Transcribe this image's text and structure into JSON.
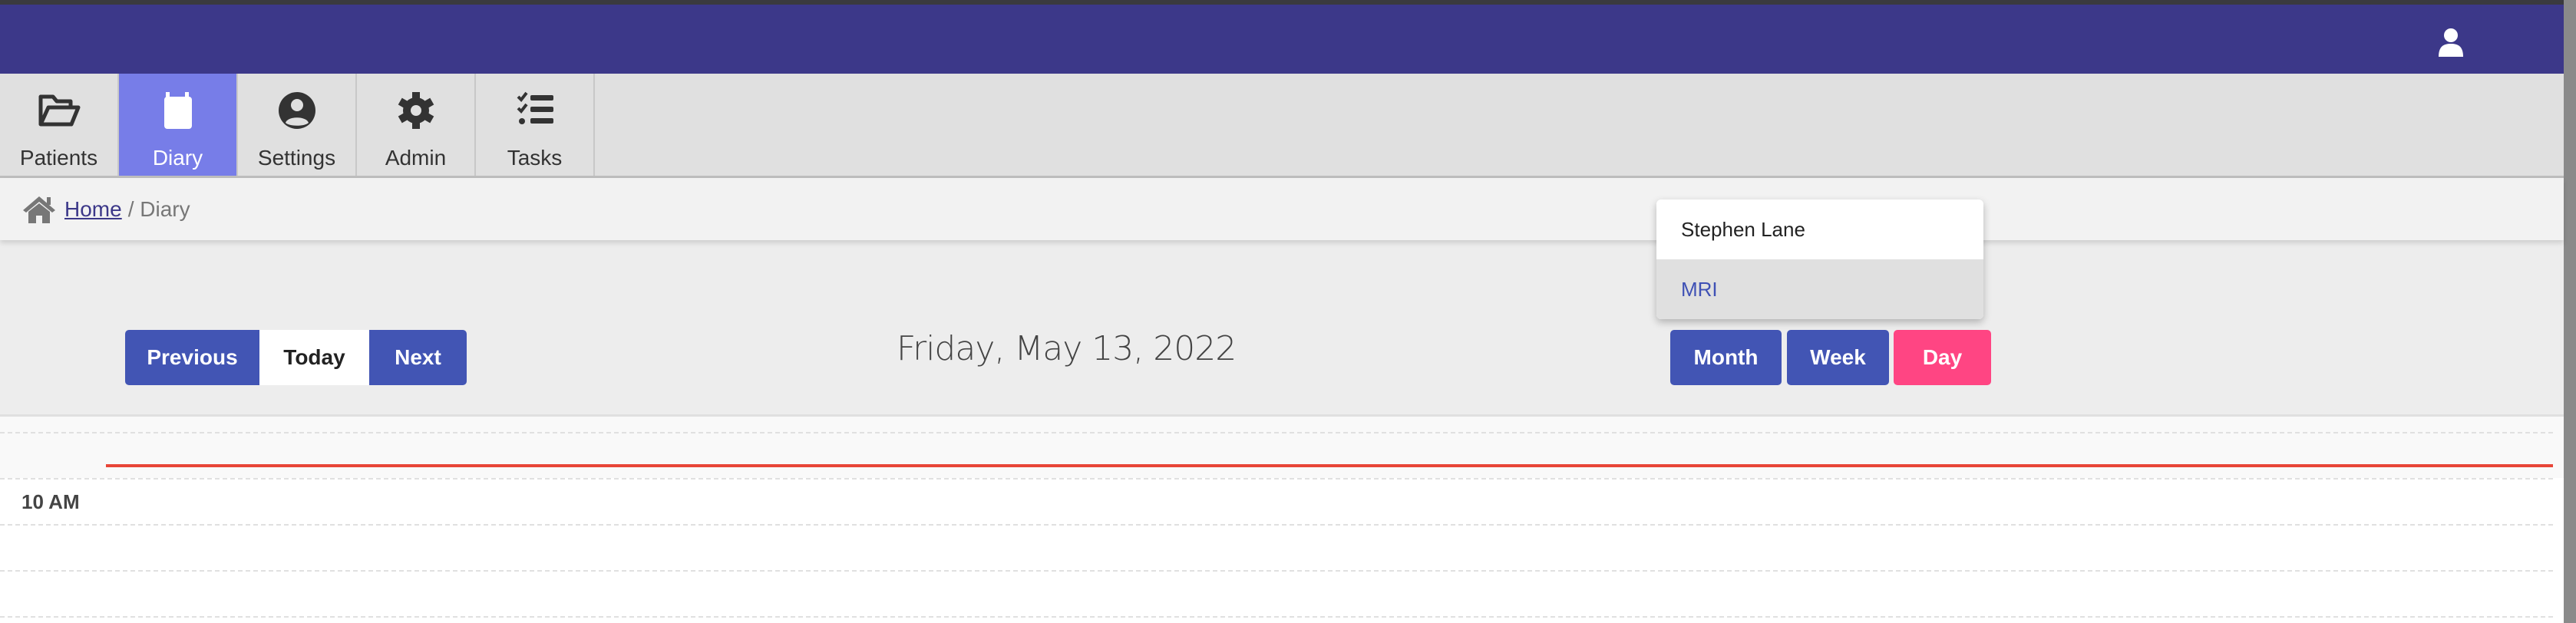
{
  "nav": {
    "tabs": [
      {
        "label": "Patients",
        "icon": "folder-open-icon"
      },
      {
        "label": "Diary",
        "icon": "calendar-icon",
        "active": true
      },
      {
        "label": "Settings",
        "icon": "user-circle-icon"
      },
      {
        "label": "Admin",
        "icon": "gear-icon"
      },
      {
        "label": "Tasks",
        "icon": "tasks-icon"
      }
    ]
  },
  "breadcrumb": {
    "home": "Home",
    "separator": "/",
    "current": "Diary"
  },
  "toolbar": {
    "previous": "Previous",
    "today": "Today",
    "next": "Next",
    "date": "Friday, May 13, 2022",
    "month": "Month",
    "week": "Week",
    "day": "Day"
  },
  "dropdown": {
    "items": [
      "Stephen Lane",
      "MRI"
    ]
  },
  "calendar": {
    "hour_label": "10 AM"
  },
  "colors": {
    "header": "#3c3889",
    "active_tab": "#777de8",
    "primary_button": "#4255b4",
    "active_view": "#ff4583",
    "now_line": "#e84538"
  }
}
